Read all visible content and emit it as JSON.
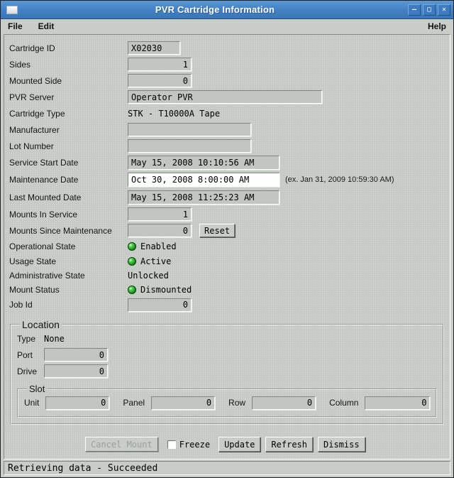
{
  "window": {
    "title": "PVR Cartridge Information",
    "buttons": {
      "minimize": "—",
      "maximize": "▢",
      "close": "✕"
    }
  },
  "menubar": {
    "file": "File",
    "edit": "Edit",
    "help": "Help"
  },
  "form": {
    "cartridge_id": {
      "label": "Cartridge ID",
      "value": "X02030"
    },
    "sides": {
      "label": "Sides",
      "value": "1"
    },
    "mounted_side": {
      "label": "Mounted Side",
      "value": "0"
    },
    "pvr_server": {
      "label": "PVR Server",
      "value": "Operator PVR"
    },
    "cartridge_type": {
      "label": "Cartridge Type",
      "value": "STK - T10000A Tape"
    },
    "manufacturer": {
      "label": "Manufacturer",
      "value": ""
    },
    "lot_number": {
      "label": "Lot Number",
      "value": ""
    },
    "service_start_date": {
      "label": "Service Start Date",
      "value": "May 15, 2008 10:10:56 AM"
    },
    "maintenance_date": {
      "label": "Maintenance Date",
      "value": "Oct 30, 2008 8:00:00 AM",
      "hint": "(ex. Jan 31, 2009 10:59:30 AM)"
    },
    "last_mounted_date": {
      "label": "Last Mounted Date",
      "value": "May 15, 2008 11:25:23 AM"
    },
    "mounts_in_service": {
      "label": "Mounts In Service",
      "value": "1"
    },
    "mounts_since_maintenance": {
      "label": "Mounts Since Maintenance",
      "value": "0",
      "reset_label": "Reset"
    },
    "operational_state": {
      "label": "Operational State",
      "value": "Enabled",
      "led": "green"
    },
    "usage_state": {
      "label": "Usage State",
      "value": "Active",
      "led": "green"
    },
    "administrative_state": {
      "label": "Administrative State",
      "value": "Unlocked"
    },
    "mount_status": {
      "label": "Mount Status",
      "value": "Dismounted",
      "led": "green"
    },
    "job_id": {
      "label": "Job Id",
      "value": "0"
    }
  },
  "location": {
    "title": "Location",
    "type": {
      "label": "Type",
      "value": "None"
    },
    "port": {
      "label": "Port",
      "value": "0"
    },
    "drive": {
      "label": "Drive",
      "value": "0"
    },
    "slot": {
      "title": "Slot",
      "unit": {
        "label": "Unit",
        "value": "0"
      },
      "panel": {
        "label": "Panel",
        "value": "0"
      },
      "row": {
        "label": "Row",
        "value": "0"
      },
      "column": {
        "label": "Column",
        "value": "0"
      }
    }
  },
  "actions": {
    "cancel_mount": "Cancel Mount",
    "freeze": "Freeze",
    "update": "Update",
    "refresh": "Refresh",
    "dismiss": "Dismiss"
  },
  "statusbar": {
    "text": "Retrieving data - Succeeded"
  },
  "colors": {
    "titlebar_blue": "#4484c6",
    "window_bg": "#c9cdc7",
    "field_bg": "#c2c6c0",
    "editable_bg": "#ffffff",
    "led_green": "#129012"
  }
}
